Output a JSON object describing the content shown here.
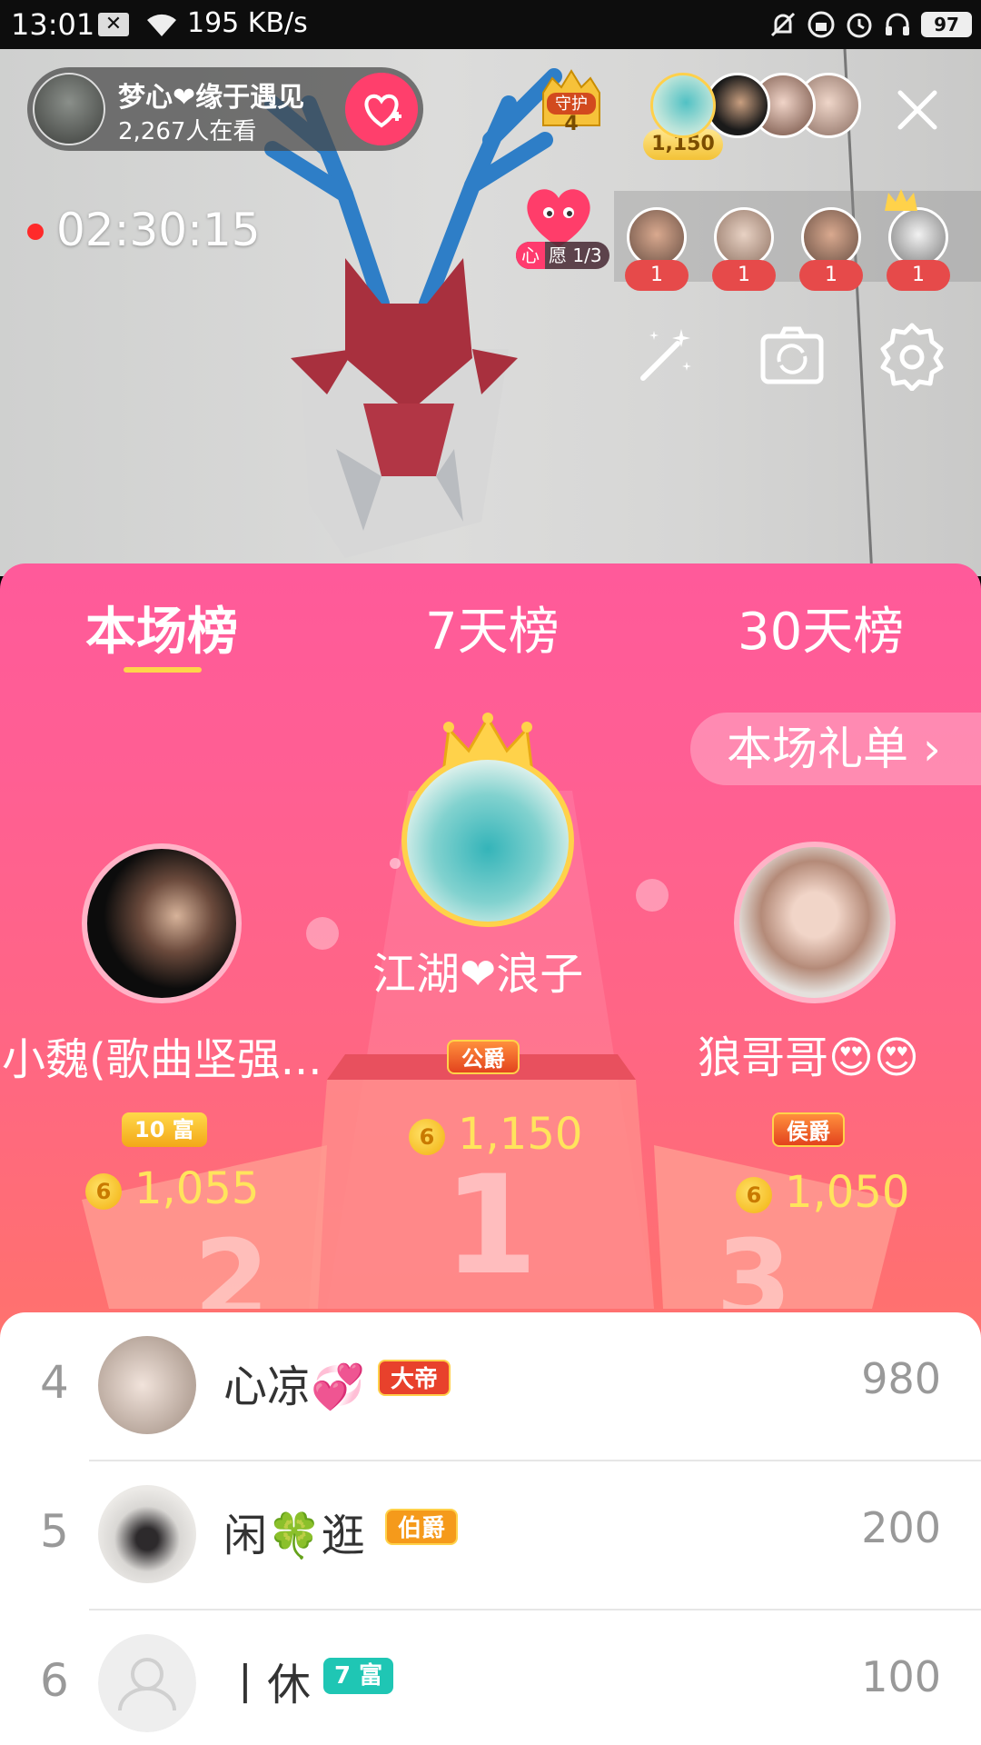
{
  "status_bar": {
    "time": "13:01",
    "speed": "195 KB/s",
    "battery": "97",
    "icons": [
      "notification-x-icon",
      "wifi-icon",
      "mute-icon",
      "lock-icon",
      "alarm-icon",
      "headset-icon",
      "battery-icon"
    ]
  },
  "live": {
    "host_name": "梦心❤缘于遇见",
    "viewers": "2,267人在看",
    "guard_label": "守护",
    "guard_count": "4",
    "top_coins": "1,150",
    "timer": "02:30:15",
    "wish_prefix": "心",
    "wish_text": "愿 1/3",
    "gift_counts": [
      "1",
      "1",
      "1",
      "1"
    ]
  },
  "board": {
    "tabs": [
      {
        "label": "本场榜",
        "active": true
      },
      {
        "label": "7天榜",
        "active": false
      },
      {
        "label": "30天榜",
        "active": false
      }
    ],
    "order_button": "本场礼单 ›",
    "podium": {
      "first": {
        "name": "江湖❤浪子",
        "badge": "公爵",
        "score": "1,150"
      },
      "second": {
        "name": "小魏(歌曲坚强...",
        "badge": "10 富",
        "score": "1,055"
      },
      "third": {
        "name": "狼哥哥😍😍",
        "badge": "侯爵",
        "score": "1,050"
      }
    },
    "podium_numbers": [
      "1",
      "2",
      "3"
    ]
  },
  "list": [
    {
      "rank": "4",
      "name": "心凉💞",
      "badge": "大帝",
      "badge_color": "#e8412c",
      "score": "980"
    },
    {
      "rank": "5",
      "name": "闲🍀逛",
      "badge": "伯爵",
      "badge_color": "#f59a1b",
      "score": "200"
    },
    {
      "rank": "6",
      "name": "丨休",
      "badge": "7 富",
      "badge_color": "#1fc6b4",
      "score": "100"
    }
  ],
  "coin_symbol": "6",
  "colors": {
    "accent_pink": "#ff3f6c",
    "board_top": "#ff5a9a",
    "board_bottom": "#ff8a6c",
    "score_gold": "#ffe45c",
    "tab_underline": "#ffd54a"
  }
}
